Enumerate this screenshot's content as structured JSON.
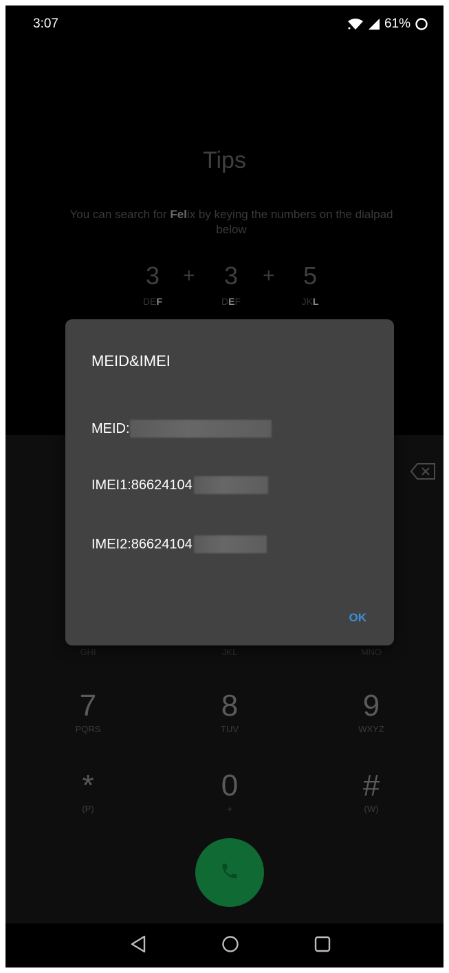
{
  "status_bar": {
    "time": "3:07",
    "battery": "61%"
  },
  "tips": {
    "title": "Tips",
    "text_prefix": "You can search for ",
    "text_bold": "Fel",
    "text_suffix": "ix by keying the numbers on the dialpad below",
    "sequence": [
      {
        "digit": "3",
        "letters_dim": "DE",
        "letters_bold": "F",
        "letters_after": ""
      },
      {
        "digit": "3",
        "letters_dim": "D",
        "letters_bold": "E",
        "letters_after": "F"
      },
      {
        "digit": "5",
        "letters_dim": "JK",
        "letters_bold": "L",
        "letters_after": ""
      }
    ],
    "plus": "+"
  },
  "dialpad": {
    "partial_row": [
      "GHI",
      "JKL",
      "MNO"
    ],
    "keys": [
      {
        "digit": "7",
        "letters": "PQRS"
      },
      {
        "digit": "8",
        "letters": "TUV"
      },
      {
        "digit": "9",
        "letters": "WXYZ"
      },
      {
        "digit": "*",
        "letters": "(P)"
      },
      {
        "digit": "0",
        "letters": "+"
      },
      {
        "digit": "#",
        "letters": "(W)"
      }
    ]
  },
  "dialog": {
    "title": "MEID&IMEI",
    "meid_label": "MEID:",
    "imei1_label": "IMEI1:86624104",
    "imei2_label": "IMEI2:86624104",
    "ok_label": "OK"
  },
  "colors": {
    "accent": "#3d8fd6",
    "call_button": "#0f6a34",
    "dialog_bg": "#424242"
  },
  "icons": {
    "wifi": "wifi-icon",
    "signal": "signal-icon",
    "battery": "battery-icon",
    "backspace": "backspace-icon",
    "phone": "phone-icon",
    "back": "back-icon",
    "home": "home-icon",
    "recents": "recents-icon"
  }
}
